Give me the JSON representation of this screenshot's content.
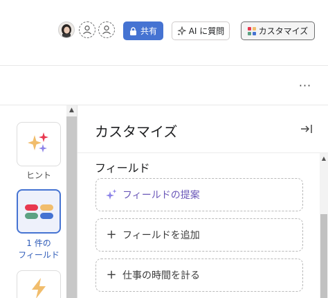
{
  "header": {
    "share_label": "共有",
    "ai_label": "AI に質問",
    "customize_label": "カスタマイズ",
    "more_label": "···"
  },
  "rail": {
    "hint_label": "ヒント",
    "fields_label_line1": "1 件の",
    "fields_label_line2": "フィールド"
  },
  "panel": {
    "title": "カスタマイズ",
    "section_title": "フィールド",
    "suggest_label": "フィールドの提案",
    "add_field_label": "フィールドを追加",
    "time_tracking_label": "仕事の時間を計る"
  },
  "icons": {
    "share": "lock-icon",
    "ai": "sparkle-icon",
    "customize": "grid-icon",
    "collapse": "collapse-right-icon",
    "hint": "sparkles-icon",
    "fields": "fields-chips-icon",
    "automation": "lightning-icon"
  },
  "colors": {
    "primary": "#4573d2",
    "ai_purple": "#6a57b8",
    "chip_red": "#e8384f",
    "chip_yellow": "#f1bd6c",
    "chip_green": "#5da283",
    "chip_blue": "#4573d2"
  }
}
